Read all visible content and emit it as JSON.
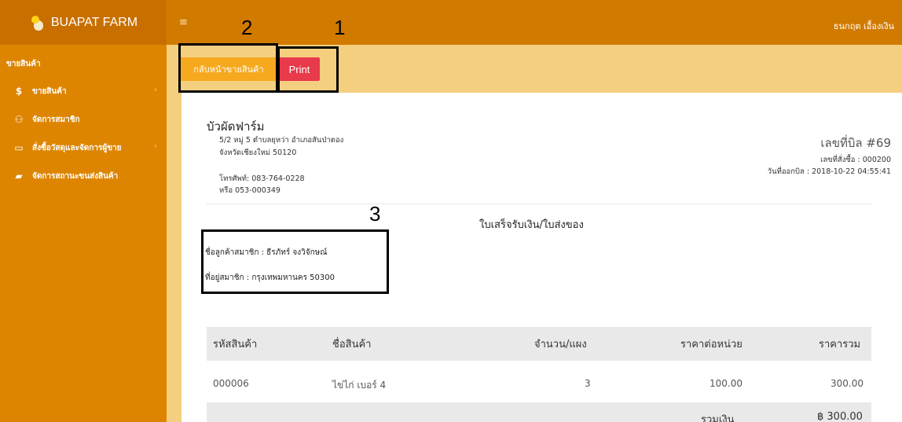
{
  "brand": {
    "title": "BUAPAT FARM",
    "logo_icon": "chick-egg-logo"
  },
  "header": {
    "menu_icon": "≡",
    "user_name": "ธนกฤต เอื้องเงิน"
  },
  "sidebar": {
    "heading": "ขายสินค้า",
    "items": [
      {
        "icon": "$",
        "label": "ขายสินค้า",
        "chevron": "›"
      },
      {
        "icon": "⚇",
        "label": "จัดการสมาชิก",
        "chevron": ""
      },
      {
        "icon": "▭",
        "label": "สั่งซื้อวัสดุและจัดการผู้ขาย",
        "chevron": "›"
      },
      {
        "icon": "▰",
        "label": "จัดการสถานะขนส่งสินค้า",
        "chevron": ""
      }
    ]
  },
  "toolbar": {
    "back_label": "กลับหน้าขายสินค้า",
    "print_label": "Print"
  },
  "invoice": {
    "farm_name": "บัวผัดฟาร์ม",
    "address_line1": "5/2 หมู่ 5 ตำบลยุหว่า อำเภอสันป่าตอง",
    "address_line2": "จังหวัดเชียงใหม่ 50120",
    "phone1": "โทรศัพท์: 083-764-0228",
    "phone2": "หรือ 053-000349",
    "bill_no": "เลขที่บิล #69",
    "order_no": "เลขที่สั่งซื้อ : 000200",
    "issue_date": "วันที่ออกบิล : 2018-10-22 04:55:41",
    "title": "ใบเสร็จรับเงิน/ใบส่งของ",
    "customer_name": "ชื่อลูกค้าสมาชิก : ธีรภัทร์ จงวิจักษณ์",
    "customer_address": "ที่อยู่สมาชิก : กรุงเทพมหานคร 50300",
    "columns": [
      "รหัสสินค้า",
      "ชื่อสินค้า",
      "จำนวน/แผง",
      "ราคาต่อหน่วย",
      "ราคารวม"
    ],
    "rows": [
      {
        "code": "000006",
        "name": "ไข่ไก่ เบอร์ 4",
        "qty": "3",
        "unit_price": "100.00",
        "total": "300.00"
      }
    ],
    "total_label": "รวมเงิน",
    "total_value": "฿ 300.00"
  },
  "annotations": {
    "n1": "1",
    "n2": "2",
    "n3": "3"
  }
}
